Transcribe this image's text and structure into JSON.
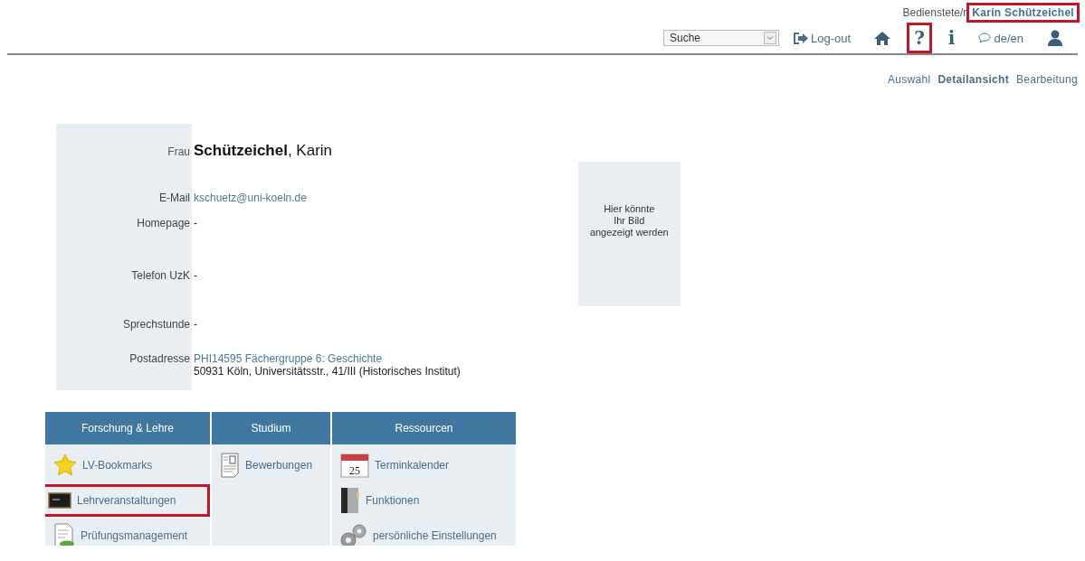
{
  "header": {
    "role": "Bedienstete/r",
    "user_name": "Karin Schützeichel",
    "user_highlighted": true
  },
  "search": {
    "value": "Suche"
  },
  "toolbar": [
    {
      "kind": "logout",
      "label": "Log-out",
      "highlighted": false
    },
    {
      "kind": "home",
      "highlighted": false
    },
    {
      "kind": "char",
      "label": "?",
      "highlighted": true
    },
    {
      "kind": "char",
      "label": "i",
      "highlighted": false
    },
    {
      "kind": "language",
      "label": "de/en",
      "highlighted": false
    },
    {
      "kind": "user",
      "highlighted": false
    }
  ],
  "views": [
    {
      "label": "Auswahl",
      "selected": false
    },
    {
      "label": "Detailansicht",
      "selected": true
    },
    {
      "label": "Bearbeitung",
      "selected": false
    }
  ],
  "profile": {
    "salutation": "Frau",
    "surname": "Schützeichel",
    "given_name": ", Karin",
    "fields": [
      {
        "label": "E-Mail",
        "lines": [
          "kschuetz@uni-koeln.de"
        ],
        "kind": "link"
      },
      {
        "label": "Homepage",
        "lines": [
          "-"
        ],
        "kind": "text"
      },
      {
        "label": "Telefon  UzK",
        "lines": [
          "-"
        ],
        "kind": "text"
      },
      {
        "label": "Sprechstunde",
        "lines": [
          "-"
        ],
        "kind": "text"
      },
      {
        "label": "Postadresse",
        "lines": [
          "PHI14595 Fächergruppe 6: Geschichte",
          "50931 Köln, Universitätsstr., 41/III (Historisches Institut)"
        ],
        "kind": "address"
      }
    ]
  },
  "photo_placeholder": "Hier könnte\nIhr Bild\nangezeigt werden",
  "menu": [
    {
      "heading": "Forschung & Lehre",
      "items": [
        {
          "label": "LV-Bookmarks",
          "kind": "star",
          "highlighted": false
        },
        {
          "label": "Lehrveranstaltungen",
          "kind": "chalkboard",
          "highlighted": true
        },
        {
          "label": "Prüfungsmanagement",
          "kind": "exam",
          "highlighted": false
        }
      ]
    },
    {
      "heading": "Studium",
      "items": [
        {
          "label": "Bewerbungen",
          "kind": "document",
          "highlighted": false
        }
      ]
    },
    {
      "heading": "Ressourcen",
      "items": [
        {
          "label": "Terminkalender",
          "kind": "calendar",
          "icon_text": "25",
          "highlighted": false
        },
        {
          "label": "Funktionen",
          "kind": "binder",
          "highlighted": false
        },
        {
          "label": "persönliche Einstellungen",
          "kind": "gears",
          "highlighted": false
        }
      ]
    }
  ]
}
